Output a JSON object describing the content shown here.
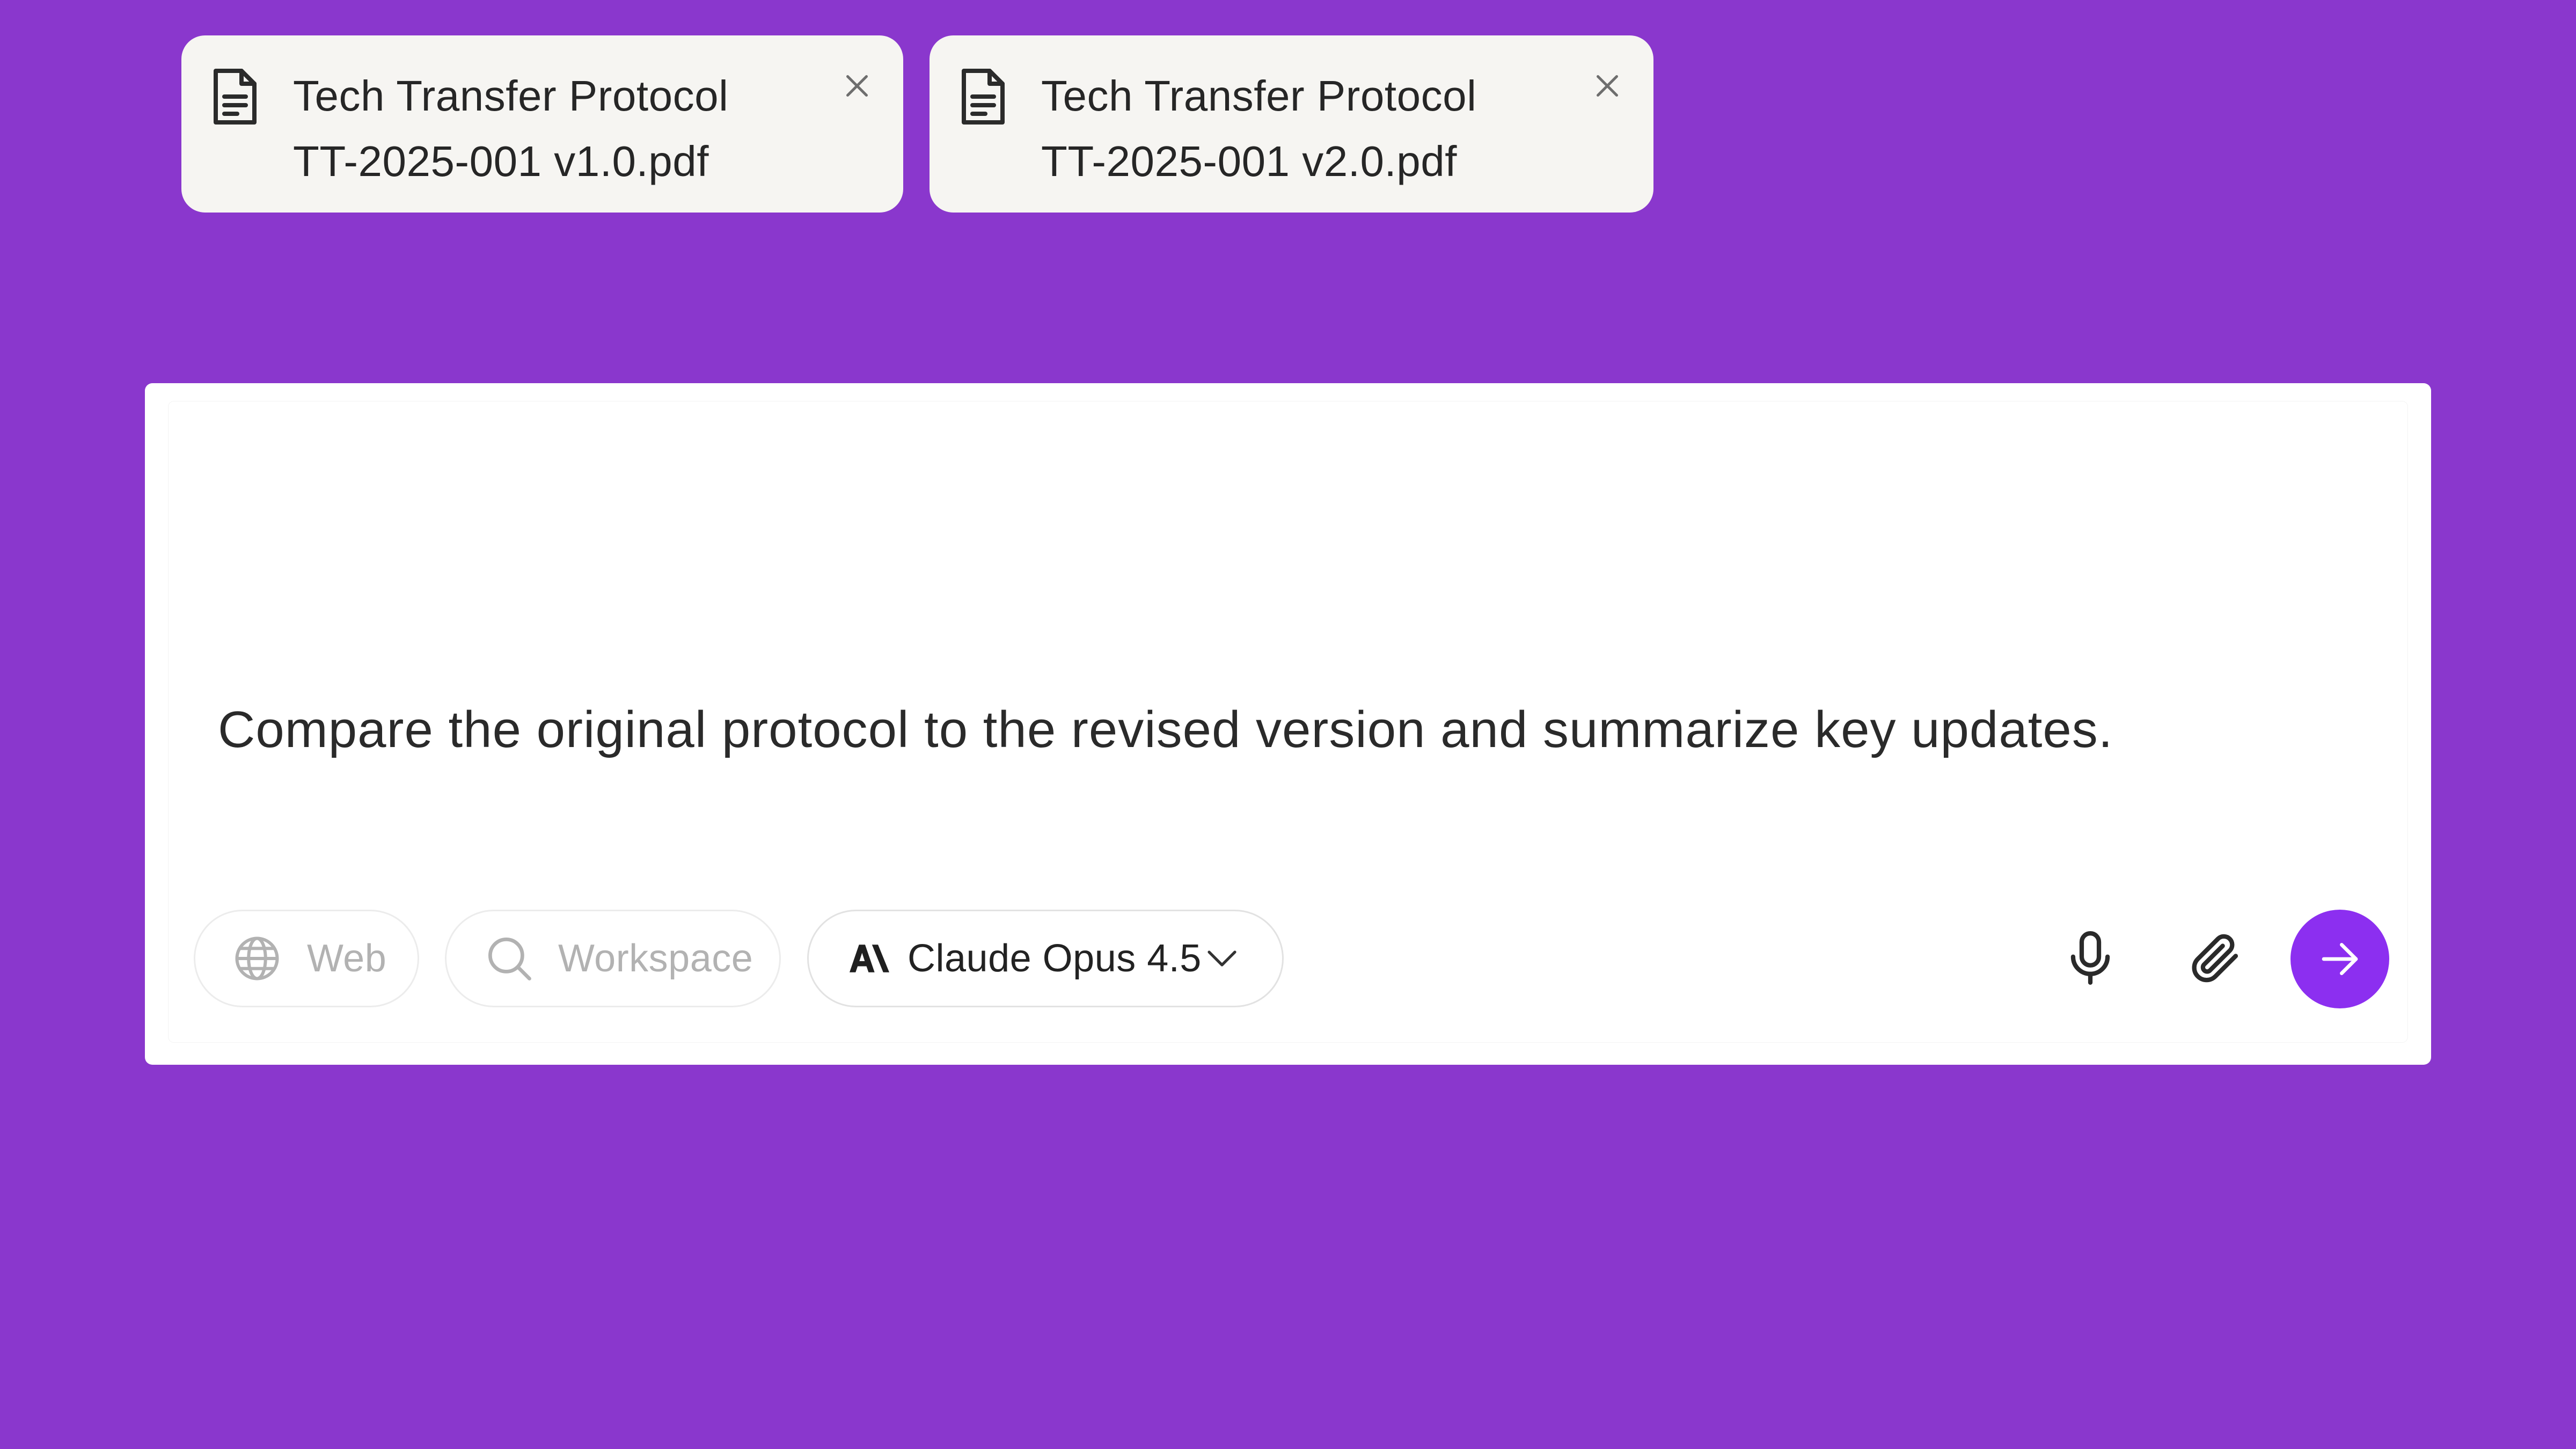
{
  "composer": {
    "attachments": [
      {
        "line1": "Tech Transfer Protocol",
        "line2": "TT-2025-001 v1.0.pdf",
        "icon": "document-icon",
        "remove_icon": "close-icon"
      },
      {
        "line1": "Tech Transfer Protocol",
        "line2": "TT-2025-001 v2.0.pdf",
        "icon": "document-icon",
        "remove_icon": "close-icon"
      }
    ],
    "prompt": "Compare the original protocol to the revised version and summarize key updates.",
    "toolbar": {
      "web_label": "Web",
      "web_icon": "globe-icon",
      "workspace_label": "Workspace",
      "workspace_icon": "search-icon",
      "model_label": "Claude Opus 4.5",
      "model_icon": "anthropic-logo-icon",
      "model_dropdown_icon": "chevron-down-icon",
      "mic_icon": "microphone-icon",
      "attach_icon": "paperclip-icon",
      "send_icon": "arrow-right-icon"
    }
  },
  "colors": {
    "background": "#8a37cd",
    "panel": "#ffffff",
    "attachment_bg": "#f6f5f2",
    "send_button": "#8c2ff0",
    "disabled_text": "#b2b2b2"
  }
}
